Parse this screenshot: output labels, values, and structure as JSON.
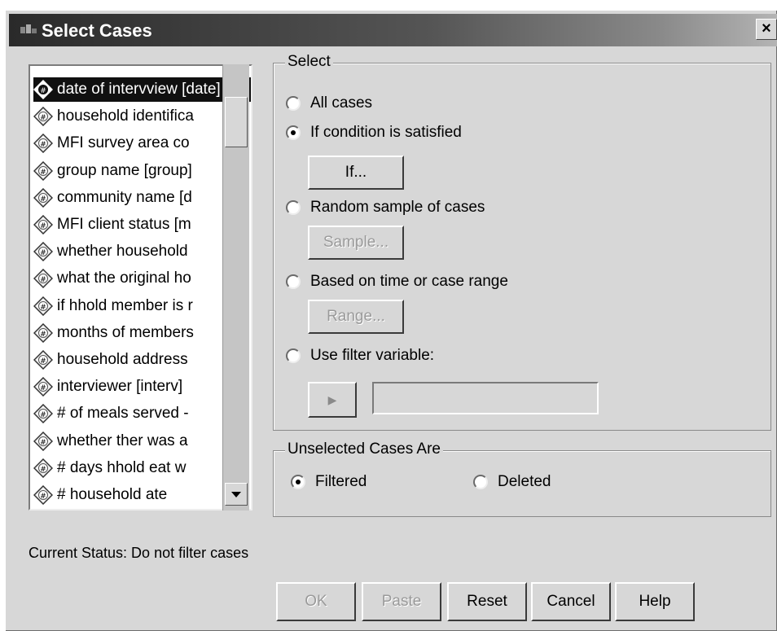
{
  "window": {
    "title": "Select Cases",
    "close_label": "×"
  },
  "variables": [
    {
      "label": "date of intervview [date]",
      "selected": true
    },
    {
      "label": "household identifica",
      "selected": false
    },
    {
      "label": "MFI survey area co",
      "selected": false
    },
    {
      "label": "group name [group]",
      "selected": false
    },
    {
      "label": "community name [d",
      "selected": false
    },
    {
      "label": "MFI client status [m",
      "selected": false
    },
    {
      "label": "whether household",
      "selected": false
    },
    {
      "label": "what the original ho",
      "selected": false
    },
    {
      "label": "if hhold member is r",
      "selected": false
    },
    {
      "label": "months of members",
      "selected": false
    },
    {
      "label": "household address",
      "selected": false
    },
    {
      "label": "interviewer [interv]",
      "selected": false
    },
    {
      "label": "# of meals served -",
      "selected": false
    },
    {
      "label": "whether ther was a",
      "selected": false
    },
    {
      "label": "# days hhold eat w",
      "selected": false
    },
    {
      "label": "# household ate",
      "selected": false
    }
  ],
  "select_group": {
    "legend": "Select",
    "all_cases": "All cases",
    "if_condition": "If condition is satisfied",
    "if_button": "If...",
    "random_sample": "Random sample of cases",
    "sample_button": "Sample...",
    "time_range": "Based on time or case range",
    "range_button": "Range...",
    "filter_variable": "Use filter variable:",
    "arrow_button": "▶",
    "selected_option": "if_condition"
  },
  "unselected_group": {
    "legend": "Unselected Cases Are",
    "filtered": "Filtered",
    "deleted": "Deleted",
    "selected_option": "filtered"
  },
  "status": "Current Status: Do not filter cases",
  "buttons": {
    "ok": "OK",
    "paste": "Paste",
    "reset": "Reset",
    "cancel": "Cancel",
    "help": "Help"
  }
}
